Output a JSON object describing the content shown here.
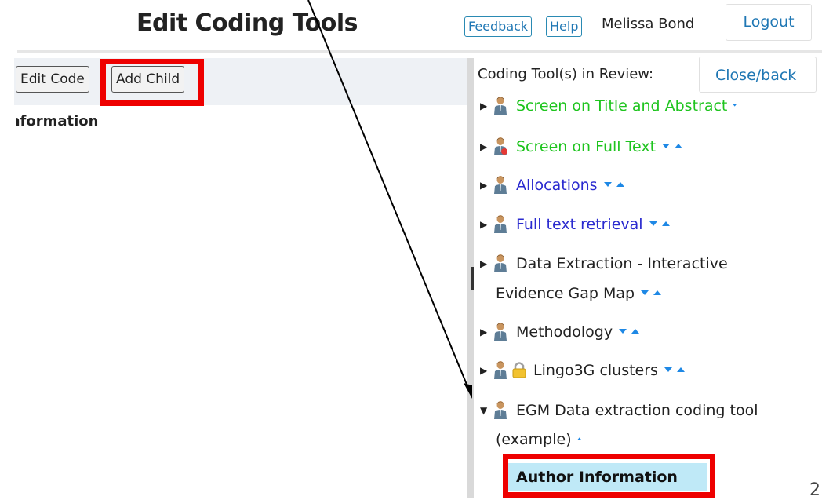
{
  "header": {
    "title": "Edit Coding Tools",
    "feedback_label": "Feedback",
    "help_label": "Help",
    "user_name": "Melissa Bond",
    "logout_label": "Logout"
  },
  "toolbar": {
    "edit_code_label": "Edit Code",
    "add_child_label": "Add Child"
  },
  "left_panel": {
    "heading": "Information"
  },
  "review_panel": {
    "label": "Coding Tool(s) in Review:",
    "close_back_label": "Close/back",
    "items": [
      {
        "label": "Screen on Title and Abstract",
        "color": "#1ec41e",
        "expanded": false,
        "arrows": "down",
        "icon": "person-icon"
      },
      {
        "label": "Screen on Full Text",
        "color": "#1ec41e",
        "expanded": false,
        "arrows": "down-up",
        "icon": "person-red-icon"
      },
      {
        "label": "Allocations",
        "color": "#2a2acf",
        "expanded": false,
        "arrows": "down-up",
        "icon": "person-icon"
      },
      {
        "label": "Full text retrieval",
        "color": "#2a2acf",
        "expanded": false,
        "arrows": "down-up",
        "icon": "person-icon"
      },
      {
        "label_line1": "Data Extraction - Interactive",
        "label_line2": "Evidence Gap Map",
        "color": "#222222",
        "expanded": false,
        "arrows": "down-up",
        "icon": "person-icon"
      },
      {
        "label": "Methodology",
        "color": "#222222",
        "expanded": false,
        "arrows": "down-up",
        "icon": "person-icon"
      },
      {
        "label": "Lingo3G clusters",
        "color": "#222222",
        "expanded": false,
        "arrows": "down-up",
        "icon": "person-icon",
        "extra_icon": "lock-icon"
      },
      {
        "label_line1": "EGM Data extraction coding tool",
        "label_line2": "(example)",
        "color": "#222222",
        "expanded": true,
        "arrows": "up",
        "icon": "person-icon"
      }
    ],
    "selected_child": "Author Information"
  },
  "corner_text": "2",
  "colors": {
    "accent": "#1f77b4",
    "highlight_box": "#ee0000",
    "selected_bg": "#bfe9f7"
  }
}
